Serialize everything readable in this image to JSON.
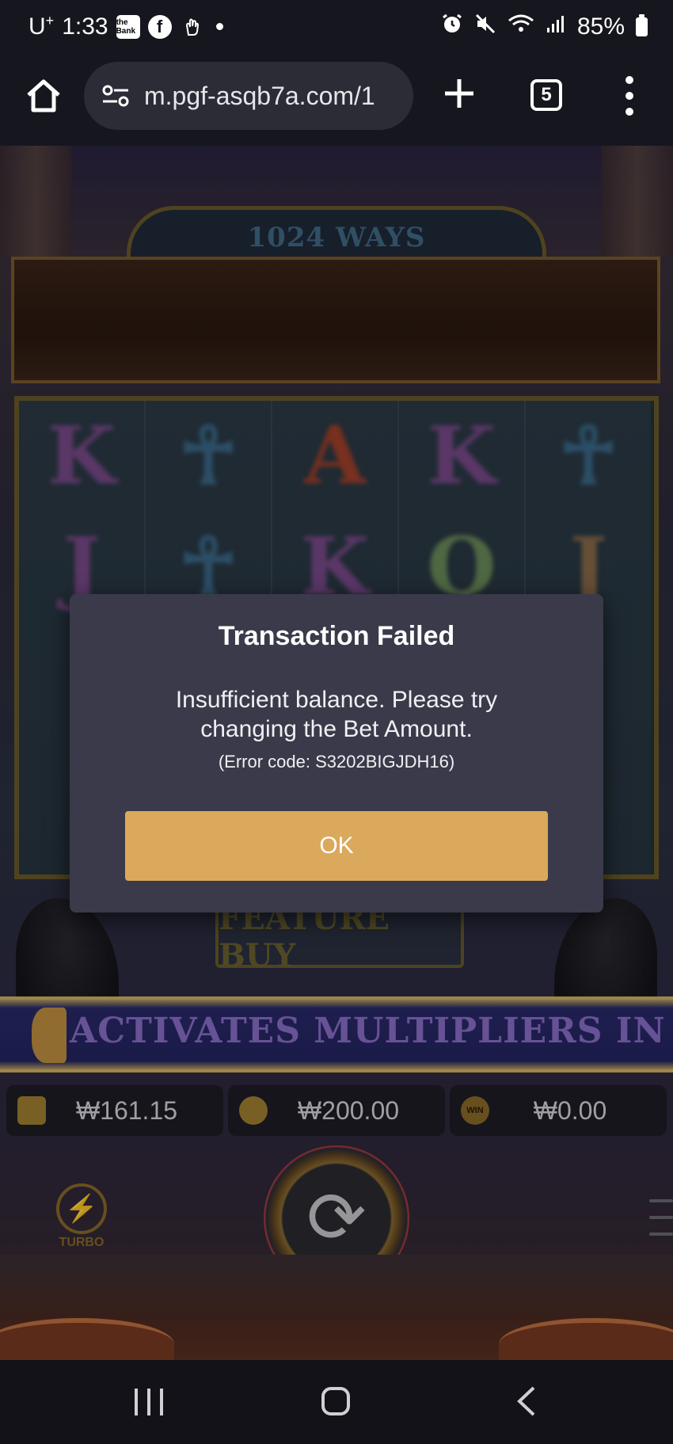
{
  "status_bar": {
    "carrier": "U",
    "carrier_sup": "+",
    "time": "1:33",
    "bank_icon_text": "the Bank",
    "battery": "85%"
  },
  "browser": {
    "url": "m.pgf-asqb7a.com/1",
    "tab_count": "5"
  },
  "game": {
    "ways_label": "1024 WAYS",
    "reels": [
      {
        "top": "K",
        "mid": "J",
        "color": "#7a4a8a"
      },
      {
        "top": "☥",
        "mid": "☥",
        "color": "#3a6a8a"
      },
      {
        "top": "A",
        "mid": "K",
        "color": "#a0402a"
      },
      {
        "top": "K",
        "mid": "Q",
        "color": "#7a4a8a"
      },
      {
        "top": "☥",
        "mid": "J",
        "color": "#3a6a8a"
      }
    ],
    "feature_buy_label": "FEATURE BUY",
    "ticker_text": "ACTIVATES MULTIPLIERS IN MULTIPLIER",
    "balance": "₩161.15",
    "bet": "₩200.00",
    "win_icon_text": "WIN",
    "win": "₩0.00",
    "turbo_label": "TURBO"
  },
  "dialog": {
    "title": "Transaction Failed",
    "message": "Insufficient balance. Please try changing the Bet Amount.",
    "error_code": "(Error code: S3202BIGJDH16)",
    "ok_label": "OK"
  },
  "colors": {
    "dialog_bg": "#3a3a4a",
    "ok_button": "#dba95c",
    "bar_bg": "#16161e"
  }
}
